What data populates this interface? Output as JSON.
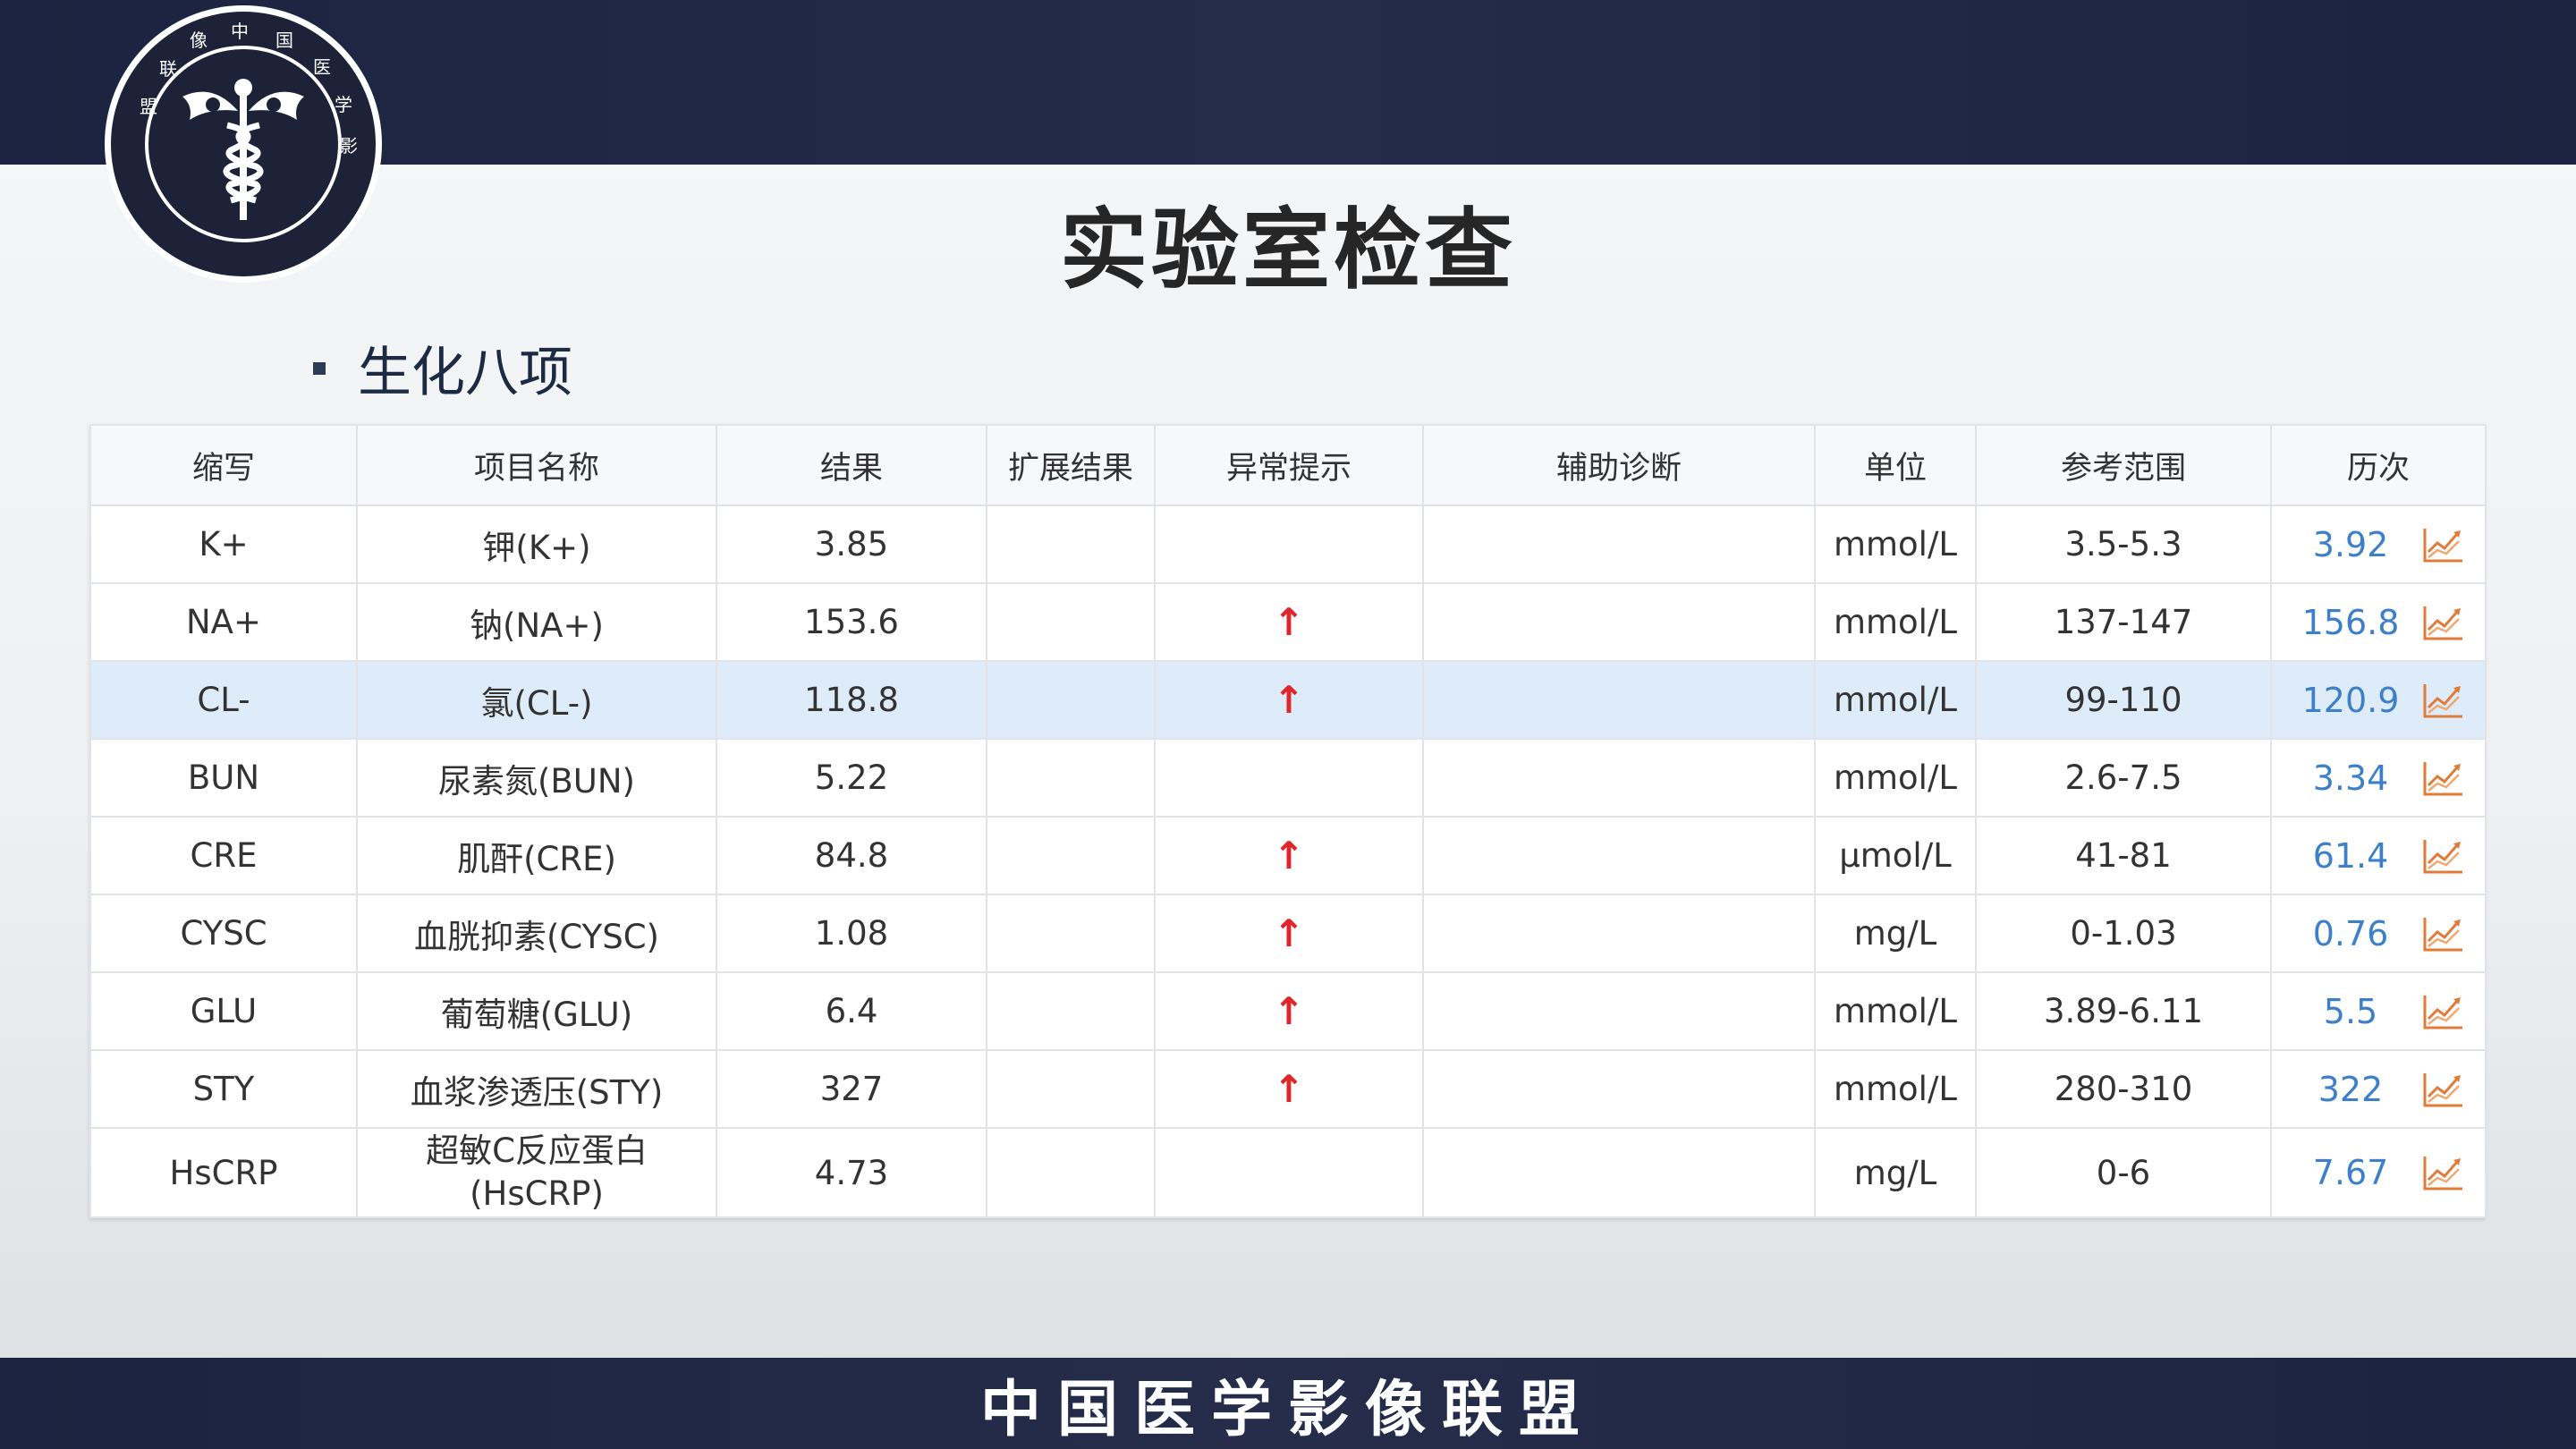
{
  "logo": {
    "text_ring": "中国医学影像联盟"
  },
  "page_title": "实验室检查",
  "section_label": "生化八项",
  "table": {
    "headers": [
      "缩写",
      "项目名称",
      "结果",
      "扩展结果",
      "异常提示",
      "辅助诊断",
      "单位",
      "参考范围",
      "历次"
    ],
    "rows": [
      {
        "abbr": "K+",
        "name": "钾(K+)",
        "result": "3.85",
        "ext": "",
        "flag": "",
        "aux": "",
        "unit": "mmol/L",
        "range": "3.5-5.3",
        "history": "3.92"
      },
      {
        "abbr": "NA+",
        "name": "钠(NA+)",
        "result": "153.6",
        "ext": "",
        "flag": "↑",
        "aux": "",
        "unit": "mmol/L",
        "range": "137-147",
        "history": "156.8"
      },
      {
        "abbr": "CL-",
        "name": "氯(CL-)",
        "result": "118.8",
        "ext": "",
        "flag": "↑",
        "aux": "",
        "unit": "mmol/L",
        "range": "99-110",
        "history": "120.9"
      },
      {
        "abbr": "BUN",
        "name": "尿素氮(BUN)",
        "result": "5.22",
        "ext": "",
        "flag": "",
        "aux": "",
        "unit": "mmol/L",
        "range": "2.6-7.5",
        "history": "3.34"
      },
      {
        "abbr": "CRE",
        "name": "肌酐(CRE)",
        "result": "84.8",
        "ext": "",
        "flag": "↑",
        "aux": "",
        "unit": "μmol/L",
        "range": "41-81",
        "history": "61.4"
      },
      {
        "abbr": "CYSC",
        "name": "血胱抑素(CYSC)",
        "result": "1.08",
        "ext": "",
        "flag": "↑",
        "aux": "",
        "unit": "mg/L",
        "range": "0-1.03",
        "history": "0.76"
      },
      {
        "abbr": "GLU",
        "name": "葡萄糖(GLU)",
        "result": "6.4",
        "ext": "",
        "flag": "↑",
        "aux": "",
        "unit": "mmol/L",
        "range": "3.89-6.11",
        "history": "5.5"
      },
      {
        "abbr": "STY",
        "name": "血浆渗透压(STY)",
        "result": "327",
        "ext": "",
        "flag": "↑",
        "aux": "",
        "unit": "mmol/L",
        "range": "280-310",
        "history": "322"
      },
      {
        "abbr": "HsCRP",
        "name": "超敏C反应蛋白",
        "name2": "(HsCRP)",
        "result": "4.73",
        "ext": "",
        "flag": "",
        "aux": "",
        "unit": "mg/L",
        "range": "0-6",
        "history": "7.67"
      }
    ]
  },
  "footer": "中国医学影像联盟",
  "colors": {
    "bar": "#1b2340",
    "flag": "#e0262b",
    "history": "#3d7fc8",
    "highlight": "#deecf9"
  },
  "icons": {
    "trend": "trend-chart-icon",
    "bullet": "square-bullet-icon"
  }
}
